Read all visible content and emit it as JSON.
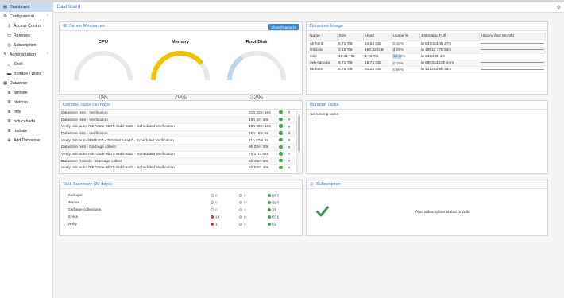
{
  "header": {
    "title": "Dashboard"
  },
  "sidebar": {
    "items": [
      {
        "label": "Dashboard",
        "icon": "dashboard-icon",
        "glyph": "▤"
      },
      {
        "label": "Configuration",
        "icon": "gear-icon",
        "glyph": "⚙"
      },
      {
        "label": "Access Control",
        "icon": "key-icon",
        "glyph": "⚷"
      },
      {
        "label": "Remotes",
        "icon": "server-icon",
        "glyph": "▭"
      },
      {
        "label": "Subscription",
        "icon": "support-icon",
        "glyph": "◎"
      },
      {
        "label": "Administration",
        "icon": "wrench-icon",
        "glyph": "✎"
      },
      {
        "label": "Shell",
        "icon": "terminal-icon",
        "glyph": ">_"
      },
      {
        "label": "Storage / Disks",
        "icon": "hdd-icon",
        "glyph": "▬"
      },
      {
        "label": "Datastore",
        "icon": "archive-icon",
        "glyph": "▦"
      },
      {
        "label": "arnhem",
        "icon": "database-icon",
        "glyph": "≣"
      },
      {
        "label": "firstcolo",
        "icon": "database-icon",
        "glyph": "≣"
      },
      {
        "label": "mits",
        "icon": "database-icon",
        "glyph": "≣"
      },
      {
        "label": "ovh-canada",
        "icon": "database-icon",
        "glyph": "≣"
      },
      {
        "label": "roubaix",
        "icon": "database-icon",
        "glyph": "≣"
      },
      {
        "label": "Add Datastore",
        "icon": "plus-circle-icon",
        "glyph": "⊕"
      }
    ]
  },
  "server": {
    "title": "Server Resources",
    "fingerprint_button": "Show Fingerprint",
    "gauges": [
      {
        "label": "CPU",
        "value_text": "0%",
        "value": 0,
        "color": "#f2c200"
      },
      {
        "label": "Memory",
        "value_text": "79%",
        "value": 79,
        "color": "#f2c200"
      },
      {
        "label": "Root Disk",
        "value_text": "32%",
        "value": 32,
        "color": "#b9d6ee"
      }
    ]
  },
  "datastore": {
    "title": "Datastore Usage",
    "columns": [
      "Name ↑",
      "Size",
      "Used",
      "Usage %",
      "Estimated Full",
      "History (last Month)"
    ],
    "rows": [
      {
        "name": "arnhem",
        "size": "8.71 TiB",
        "used": "14.54 GiB",
        "usage": "0.16%",
        "usage_value": 0.16,
        "full": "in 53202d 4h 27m"
      },
      {
        "name": "firstcolo",
        "size": "9.15 TiB",
        "used": "463.92 GiB",
        "usage": "4.95%",
        "usage_value": 4.95,
        "full": "in 1881d 17h 54m"
      },
      {
        "name": "mits",
        "size": "10.41 TiB",
        "used": "1.72 TiB",
        "usage": "16.46%",
        "usage_value": 16.46,
        "full": "in 512d 3h 4m"
      },
      {
        "name": "ovh-canada",
        "size": "8.71 TiB",
        "used": "16.74 GiB",
        "usage": "0.19%",
        "usage_value": 0.19,
        "full": "in 69031d 16h 44m"
      },
      {
        "name": "roubaix",
        "size": "8.78 TiB",
        "used": "81.22 GiB",
        "usage": "0.98%",
        "usage_value": 0.98,
        "full": "in 12126d 5h 48m"
      }
    ]
  },
  "longest": {
    "title": "Longest Tasks (30 days)",
    "rows": [
      {
        "name": "Datastore mits - Verification",
        "duration": "21h 22m 10s"
      },
      {
        "name": "Datastore mits - Verification",
        "duration": "19h 2m 40s"
      },
      {
        "name": "Verify Job auto-7eb7c8ae-9b07-45dd-9ad2 - Scheduled Verification",
        "duration": "18h 35m 10s"
      },
      {
        "name": "Datastore mits - Verification",
        "duration": "15h 16m 6s"
      },
      {
        "name": "Verify Job auto-fd69b207-4792-8a63-8a97 - Scheduled Verification",
        "duration": "11h 27m 4s"
      },
      {
        "name": "Datastore mits - Garbage collect",
        "duration": "9h 20m 20s"
      },
      {
        "name": "Verify Job auto-7eb7c8ae-9b07-45dd-9ad2 - Scheduled Verification",
        "duration": "7h 17m 54s"
      },
      {
        "name": "Datastore firstcolo - Garbage collect",
        "duration": "6h 49m 30s"
      },
      {
        "name": "Verify Job auto-7eb7c8ae-9b07-45dd-9ad2 - Scheduled Verification",
        "duration": "5h 52m 40s"
      }
    ]
  },
  "running": {
    "title": "Running Tasks",
    "empty_text": "No running tasks"
  },
  "summary": {
    "title": "Task Summary (30 days)",
    "rows": [
      {
        "label": "Backups",
        "errors": "0",
        "warnings": "0",
        "ok": "867"
      },
      {
        "label": "Prunes",
        "errors": "0",
        "warnings": "0",
        "ok": "317"
      },
      {
        "label": "Garbage collections",
        "errors": "0",
        "warnings": "0",
        "ok": "26"
      },
      {
        "label": "Syncs",
        "errors": "14",
        "warnings": "0",
        "ok": "531"
      },
      {
        "label": "Verify",
        "errors": "1",
        "warnings": "0",
        "ok": "51"
      }
    ]
  },
  "subscription": {
    "title": "Subscription",
    "status_text": "Your subscription status is valid"
  }
}
